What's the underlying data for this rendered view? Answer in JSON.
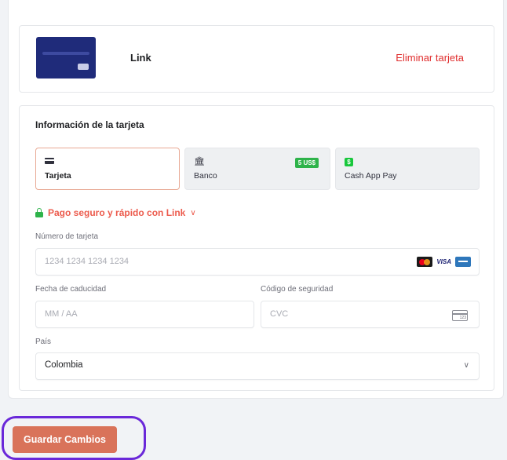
{
  "saved_card": {
    "name": "Link",
    "remove_label": "Eliminar tarjeta"
  },
  "form": {
    "title": "Información de la tarjeta",
    "methods": [
      {
        "label": "Tarjeta",
        "icon": "credit-card-icon",
        "active": true
      },
      {
        "label": "Banco",
        "icon": "bank-icon",
        "badge": "5 US$",
        "active": false
      },
      {
        "label": "Cash App Pay",
        "icon": "cash-app-icon",
        "active": false
      }
    ],
    "link_prompt": "Pago seguro y rápido con Link",
    "card_number": {
      "label": "Número de tarjeta",
      "placeholder": "1234 1234 1234 1234"
    },
    "expiry": {
      "label": "Fecha de caducidad",
      "placeholder": "MM / AA"
    },
    "cvc": {
      "label": "Código de seguridad",
      "placeholder": "CVC",
      "icon_text": "123"
    },
    "country": {
      "label": "País",
      "value": "Colombia"
    }
  },
  "actions": {
    "save_label": "Guardar Cambios"
  },
  "colors": {
    "accent": "#d9735a",
    "danger": "#e02e2e",
    "link": "#ec5b4d",
    "success": "#2eb34a",
    "highlight": "#6a28d9"
  }
}
